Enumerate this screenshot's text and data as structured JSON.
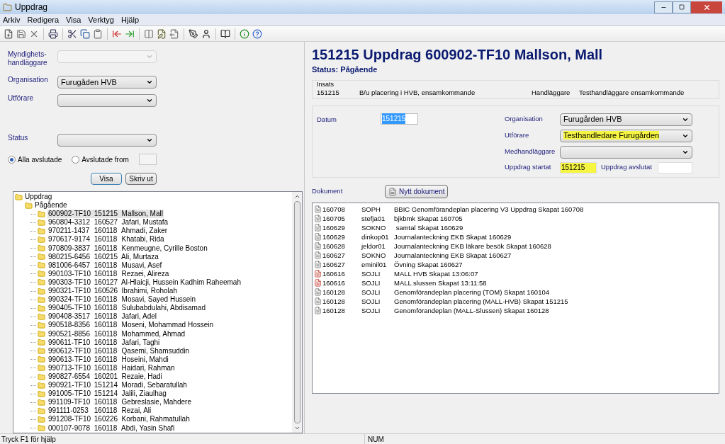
{
  "window": {
    "title": "Uppdrag"
  },
  "menu": [
    "Arkiv",
    "Redigera",
    "Visa",
    "Verktyg",
    "Hjälp"
  ],
  "toolbar": [
    {
      "kind": "new"
    },
    {
      "kind": "save"
    },
    {
      "kind": "delete"
    },
    {
      "kind": "separator"
    },
    {
      "kind": "print"
    },
    {
      "kind": "separator"
    },
    {
      "kind": "cut"
    },
    {
      "kind": "copy"
    },
    {
      "kind": "paste"
    },
    {
      "kind": "separator"
    },
    {
      "kind": "move-out"
    },
    {
      "kind": "move-in"
    },
    {
      "kind": "separator"
    },
    {
      "kind": "columns"
    },
    {
      "kind": "edit"
    },
    {
      "kind": "export"
    },
    {
      "kind": "separator"
    },
    {
      "kind": "pen"
    },
    {
      "kind": "person"
    },
    {
      "kind": "separator"
    },
    {
      "kind": "book"
    },
    {
      "kind": "separator"
    },
    {
      "kind": "info"
    },
    {
      "kind": "help"
    }
  ],
  "filters": [
    {
      "kind": "combo",
      "label": "Myndighets-\nhandläggare",
      "disabled": true
    },
    {
      "kind": "combo",
      "label": "Organisation",
      "value": "Furugåden HVB",
      "disabled": false
    },
    {
      "kind": "combo",
      "label": "Utförare",
      "disabled": false
    },
    {
      "kind": "combo",
      "label": "Status",
      "disabled": false
    }
  ],
  "radios": [
    {
      "label": "Alla avslutade",
      "selected": true
    },
    {
      "label": "Avslutade from",
      "selected": false
    }
  ],
  "filter_buttons": [
    "Visa",
    "Skriv ut"
  ],
  "tree": {
    "label": "Uppdrag",
    "children": [
      {
        "label": "Pågående",
        "children": [
          {
            "id": "600902-TF10",
            "date": "151215",
            "name": "Mallson, Mall",
            "selected": true
          },
          {
            "id": "960804-3312",
            "date": "160527",
            "name": "Jafari, Mustafa",
            "selected": false
          },
          {
            "id": "970211-1437",
            "date": "160118",
            "name": "Ahmadi, Zaker",
            "selected": false
          },
          {
            "id": "970617-9174",
            "date": "160118",
            "name": "Khatabi, Rida",
            "selected": false
          },
          {
            "id": "970809-3837",
            "date": "160118",
            "name": "Kenmeugne, Cyrille Boston",
            "selected": false
          },
          {
            "id": "980215-6456",
            "date": "160215",
            "name": "Ali, Murtaza",
            "selected": false
          },
          {
            "id": "981006-6457",
            "date": "160118",
            "name": "Musavi, Asef",
            "selected": false
          },
          {
            "id": "990103-TF10",
            "date": "160118",
            "name": "Rezaei, Alireza",
            "selected": false
          },
          {
            "id": "990303-TF10",
            "date": "160127",
            "name": "Al-Hlaicji, Hussein Kadhim Raheemah",
            "selected": false
          },
          {
            "id": "990321-TF10",
            "date": "160526",
            "name": "Ibrahimi, Roholah",
            "selected": false
          },
          {
            "id": "990324-TF10",
            "date": "160118",
            "name": "Mosavi, Sayed Hussein",
            "selected": false
          },
          {
            "id": "990405-TF10",
            "date": "160118",
            "name": "Sulubabdulahi, Abdisamad",
            "selected": false
          },
          {
            "id": "990408-3517",
            "date": "160118",
            "name": "Jafari, Adel",
            "selected": false
          },
          {
            "id": "990518-8356",
            "date": "160118",
            "name": "Moseni, Mohammad Hossein",
            "selected": false
          },
          {
            "id": "990521-8856",
            "date": "160118",
            "name": "Mohammed, Ahmad",
            "selected": false
          },
          {
            "id": "990611-TF10",
            "date": "160118",
            "name": "Jafari, Taghi",
            "selected": false
          },
          {
            "id": "990612-TF10",
            "date": "160118",
            "name": "Qasemi, Shamsuddin",
            "selected": false
          },
          {
            "id": "990613-TF10",
            "date": "160118",
            "name": "Hoseini, Mahdi",
            "selected": false
          },
          {
            "id": "990713-TF10",
            "date": "160118",
            "name": "Haidari, Rahman",
            "selected": false
          },
          {
            "id": "990827-6554",
            "date": "160201",
            "name": "Rezaie, Hadi",
            "selected": false
          },
          {
            "id": "990921-TF10",
            "date": "151214",
            "name": "Moradi, Sebaratullah",
            "selected": false
          },
          {
            "id": "991005-TF10",
            "date": "151214",
            "name": "Jalili,  Ziaulhag",
            "selected": false
          },
          {
            "id": "991109-TF10",
            "date": "160118",
            "name": "Gebreslasie, Mahdere",
            "selected": false
          },
          {
            "id": "991111-0253",
            "date": "160118",
            "name": "Rezai, Ali",
            "selected": false
          },
          {
            "id": "991208-TF10",
            "date": "160226",
            "name": "Korbani, Rahmatullah",
            "selected": false
          },
          {
            "id": "000107-9078",
            "date": "160118",
            "name": "Abdi, Yasin Shafi",
            "selected": false
          }
        ]
      }
    ]
  },
  "detail": {
    "heading": "151215 Uppdrag 600902-TF10 Mallson, Mall",
    "status": "Status: Pågående",
    "insats": {
      "legend": "Insats",
      "code": "151215",
      "description": "B/u placering i HVB, ensamkommande",
      "handler_label": "Handläggare",
      "handler": "Testhandläggare ensamkommande"
    },
    "datum": {
      "label": "Datum",
      "value": "151215",
      "selected": true
    },
    "fields": [
      {
        "label": "Organisation",
        "value": "Furugården HVB",
        "highlighted": false
      },
      {
        "label": "Utförare",
        "value": "Testhandledare Furugården",
        "highlighted": true
      },
      {
        "label": "Medhandläggare"
      }
    ],
    "dates": [
      {
        "label": "Uppdrag startat",
        "value": "151215",
        "highlighted": true
      },
      {
        "label": "Uppdrag avslutat",
        "highlighted": false
      }
    ],
    "documents_label": "Dokument",
    "new_document": "Nytt dokument",
    "documents": [
      {
        "kind": "doc",
        "date": "160708",
        "user": "SOPH",
        "title": "BBIC Genomförandeplan placering V3 Uppdrag Skapat 160708"
      },
      {
        "kind": "doc",
        "date": "160705",
        "user": "stefja01",
        "title": "bjkbmk Skapat 160705"
      },
      {
        "kind": "doc",
        "date": "160629",
        "user": "SOKNO",
        "title": " samtal Skapat 160629"
      },
      {
        "kind": "doc",
        "date": "160629",
        "user": "dinkop01",
        "title": "Journalanteckning EKB Skapat 160629"
      },
      {
        "kind": "doc",
        "date": "160628",
        "user": "jeldor01",
        "title": "Journalanteckning EKB läkare besök Skapat 160628"
      },
      {
        "kind": "doc",
        "date": "160627",
        "user": "SOKNO",
        "title": "Journalanteckning EKB Skapat 160627"
      },
      {
        "kind": "doc",
        "date": "160627",
        "user": "eminil01",
        "title": "Övning Skapat 160627"
      },
      {
        "kind": "pdf",
        "date": "160616",
        "user": "SOJLI",
        "title": "MALL HVB Skapat 13:06:07"
      },
      {
        "kind": "pdf",
        "date": "160616",
        "user": "SOJLI",
        "title": "MALL slussen Skapat 13:11:58"
      },
      {
        "kind": "doc",
        "date": "160128",
        "user": "SOJLI",
        "title": "Genomförandeplan placering (TOM) Skapat 160104"
      },
      {
        "kind": "doc",
        "date": "160128",
        "user": "SOJLI",
        "title": "Genomförandeplan placering (MALL-HVB) Skapat 151215"
      },
      {
        "kind": "doc",
        "date": "160128",
        "user": "SOJLI",
        "title": "Genomförandeplan (MALL-Slussen) Skapat 160128"
      }
    ]
  },
  "status_bar": {
    "help": "Tryck F1 för hjälp",
    "num": "NUM"
  }
}
